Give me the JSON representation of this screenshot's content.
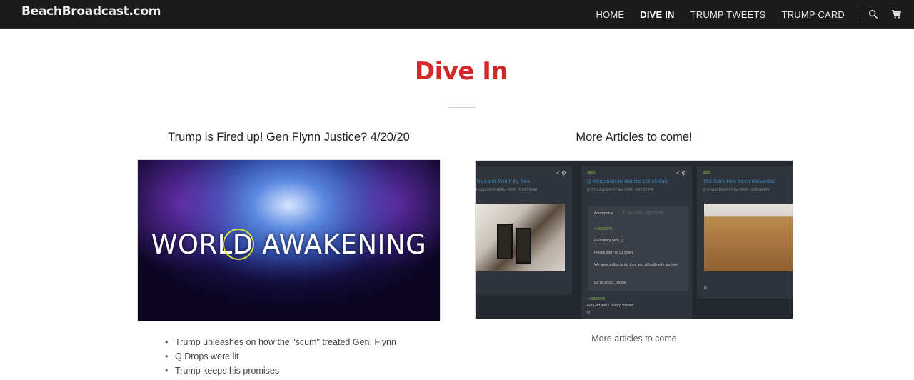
{
  "site": {
    "logo": "BeachBroadcast.com"
  },
  "nav": {
    "items": [
      {
        "label": "HOME",
        "active": false
      },
      {
        "label": "DIVE IN",
        "active": true
      },
      {
        "label": "TRUMP TWEETS",
        "active": false
      },
      {
        "label": "TRUMP CARD",
        "active": false
      }
    ],
    "icons": [
      "search-icon",
      "cart-icon"
    ]
  },
  "page": {
    "title": "Dive In",
    "accent_color": "#d4282a"
  },
  "left_article": {
    "heading": "Trump is Fired up! Gen Flynn Justice? 4/20/20",
    "image_text": "WORLD AWAKENING",
    "bullets": [
      "Trump unleashes on how the \"scum\" treated Gen. Flynn",
      "Q Drops were lit",
      "Trump keeps his promises"
    ]
  },
  "right_article": {
    "heading": "More Articles to come!",
    "caption": "More articles to come",
    "image_cards": [
      {
        "title": "f by Land Two if by Sea",
        "meta": "!!Hs1Jq13jV6  18 Apr 2020 - 1:20:12 AM"
      },
      {
        "number": "3905",
        "title": "Q Responds to Retired US Military",
        "meta": "Q !!Hs1Jq13jV6  17 Apr 2020 - 4:27:25 PM",
        "reply": {
          "author": "Anonymous",
          "time": "17 Apr 2020 - 4:25:12 PM",
          "quote": ">>8883979",
          "lines": [
            "Ex-military here, Q",
            "Please don't let us down",
            "We were willing to die then and still willing to die now",
            "Do us proud, please"
          ]
        },
        "answer_quote": ">>8883979",
        "answer": "For God and Country, Brother",
        "sign": "Q"
      },
      {
        "number": "3905",
        "title": "The Corn Has Been Harvested",
        "meta": "Q !!Hs1Jq13jV6  17 Apr 2020 - 4:25:04 PM",
        "sign": "Q"
      }
    ]
  }
}
